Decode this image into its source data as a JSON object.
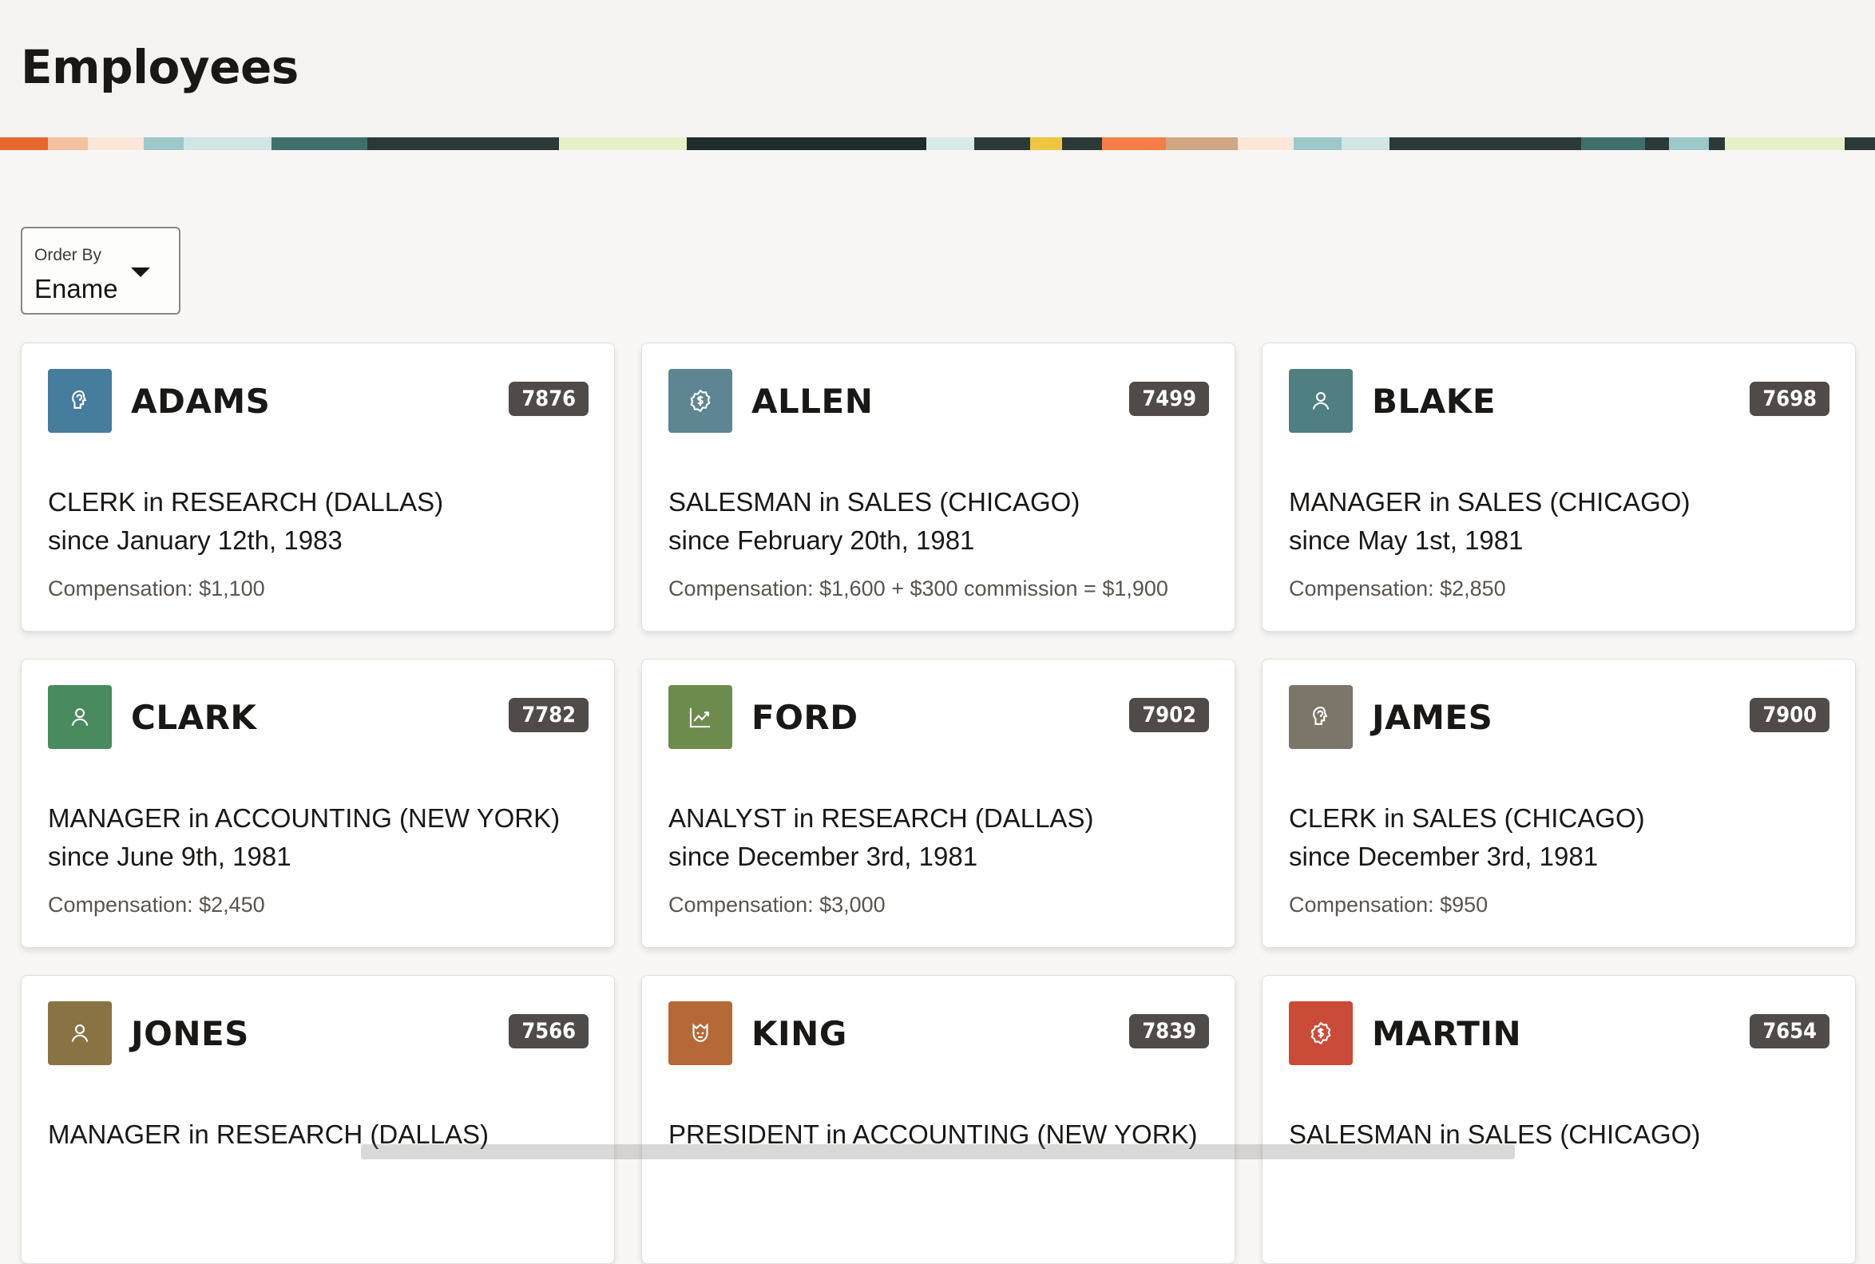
{
  "page": {
    "title": "Employees"
  },
  "order_by": {
    "label": "Order By",
    "value": "Ename"
  },
  "employees": [
    {
      "ename": "ADAMS",
      "empno": "7876",
      "job": "CLERK in RESEARCH (DALLAS)",
      "since": "since January 12th, 1983",
      "comp": "Compensation: $1,100",
      "icon": "clerk-icon",
      "color": "#467c9c"
    },
    {
      "ename": "ALLEN",
      "empno": "7499",
      "job": "SALESMAN in SALES (CHICAGO)",
      "since": "since February 20th, 1981",
      "comp": "Compensation: $1,600 + $300 commission = $1,900",
      "icon": "money-badge-icon",
      "color": "#5d8592"
    },
    {
      "ename": "BLAKE",
      "empno": "7698",
      "job": "MANAGER in SALES (CHICAGO)",
      "since": "since May 1st, 1981",
      "comp": "Compensation: $2,850",
      "icon": "person-icon",
      "color": "#4f7f80"
    },
    {
      "ename": "CLARK",
      "empno": "7782",
      "job": "MANAGER in ACCOUNTING (NEW YORK)",
      "since": "since June 9th, 1981",
      "comp": "Compensation: $2,450",
      "icon": "person-icon",
      "color": "#498a5e"
    },
    {
      "ename": "FORD",
      "empno": "7902",
      "job": "ANALYST in RESEARCH (DALLAS)",
      "since": "since December 3rd, 1981",
      "comp": "Compensation: $3,000",
      "icon": "trend-chart-icon",
      "color": "#6e8b4e"
    },
    {
      "ename": "JAMES",
      "empno": "7900",
      "job": "CLERK in SALES (CHICAGO)",
      "since": "since December 3rd, 1981",
      "comp": "Compensation: $950",
      "icon": "clerk-icon",
      "color": "#7c7668"
    },
    {
      "ename": "JONES",
      "empno": "7566",
      "job": "MANAGER in RESEARCH (DALLAS)",
      "since": "",
      "comp": "",
      "icon": "person-icon",
      "color": "#8a7343"
    },
    {
      "ename": "KING",
      "empno": "7839",
      "job": "PRESIDENT in ACCOUNTING (NEW YORK)",
      "since": "",
      "comp": "",
      "icon": "crown-face-icon",
      "color": "#b56937"
    },
    {
      "ename": "MARTIN",
      "empno": "7654",
      "job": "SALESMAN in SALES (CHICAGO)",
      "since": "",
      "comp": "",
      "icon": "money-badge-icon",
      "color": "#cb4b39"
    }
  ]
}
